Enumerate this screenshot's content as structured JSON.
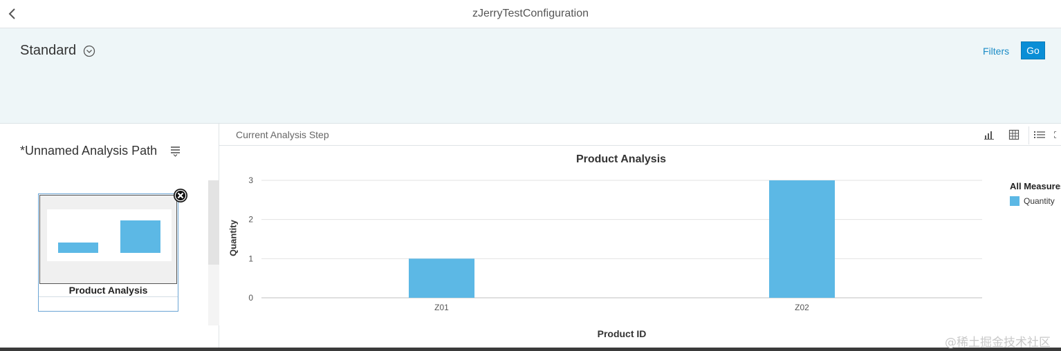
{
  "shell": {
    "title": "zJerryTestConfiguration",
    "back_icon": "chevron-left-icon"
  },
  "filterbar": {
    "variant_name": "Standard",
    "variant_icon": "chevron-down-circle-icon",
    "filters_label": "Filters",
    "go_label": "Go",
    "go_color": "#0a8ed6"
  },
  "analysis_path": {
    "title": "*Unnamed Analysis Path",
    "menu_icon": "menu-icon",
    "steps": [
      {
        "label": "Product Analysis",
        "thumbnail_values": [
          1,
          3
        ]
      }
    ],
    "remove_icon": "close-circle-icon"
  },
  "step_panel": {
    "header": "Current Analysis Step",
    "toolbar": [
      {
        "name": "bar-chart-icon"
      },
      {
        "name": "table-icon"
      },
      {
        "name": "list-icon"
      },
      {
        "name": "fullscreen-icon"
      }
    ]
  },
  "chart_data": {
    "type": "bar",
    "title": "Product Analysis",
    "xlabel": "Product ID",
    "ylabel": "Quantity",
    "categories": [
      "Z01",
      "Z02"
    ],
    "series": [
      {
        "name": "Quantity",
        "values": [
          1,
          3
        ],
        "color": "#5cb8e5"
      }
    ],
    "ylim": [
      0,
      3
    ],
    "yticks": [
      0,
      1,
      2,
      3
    ],
    "grid": true,
    "legend": {
      "title": "All Measures",
      "placement": "right"
    }
  },
  "watermark": "@稀土掘金技术社区"
}
